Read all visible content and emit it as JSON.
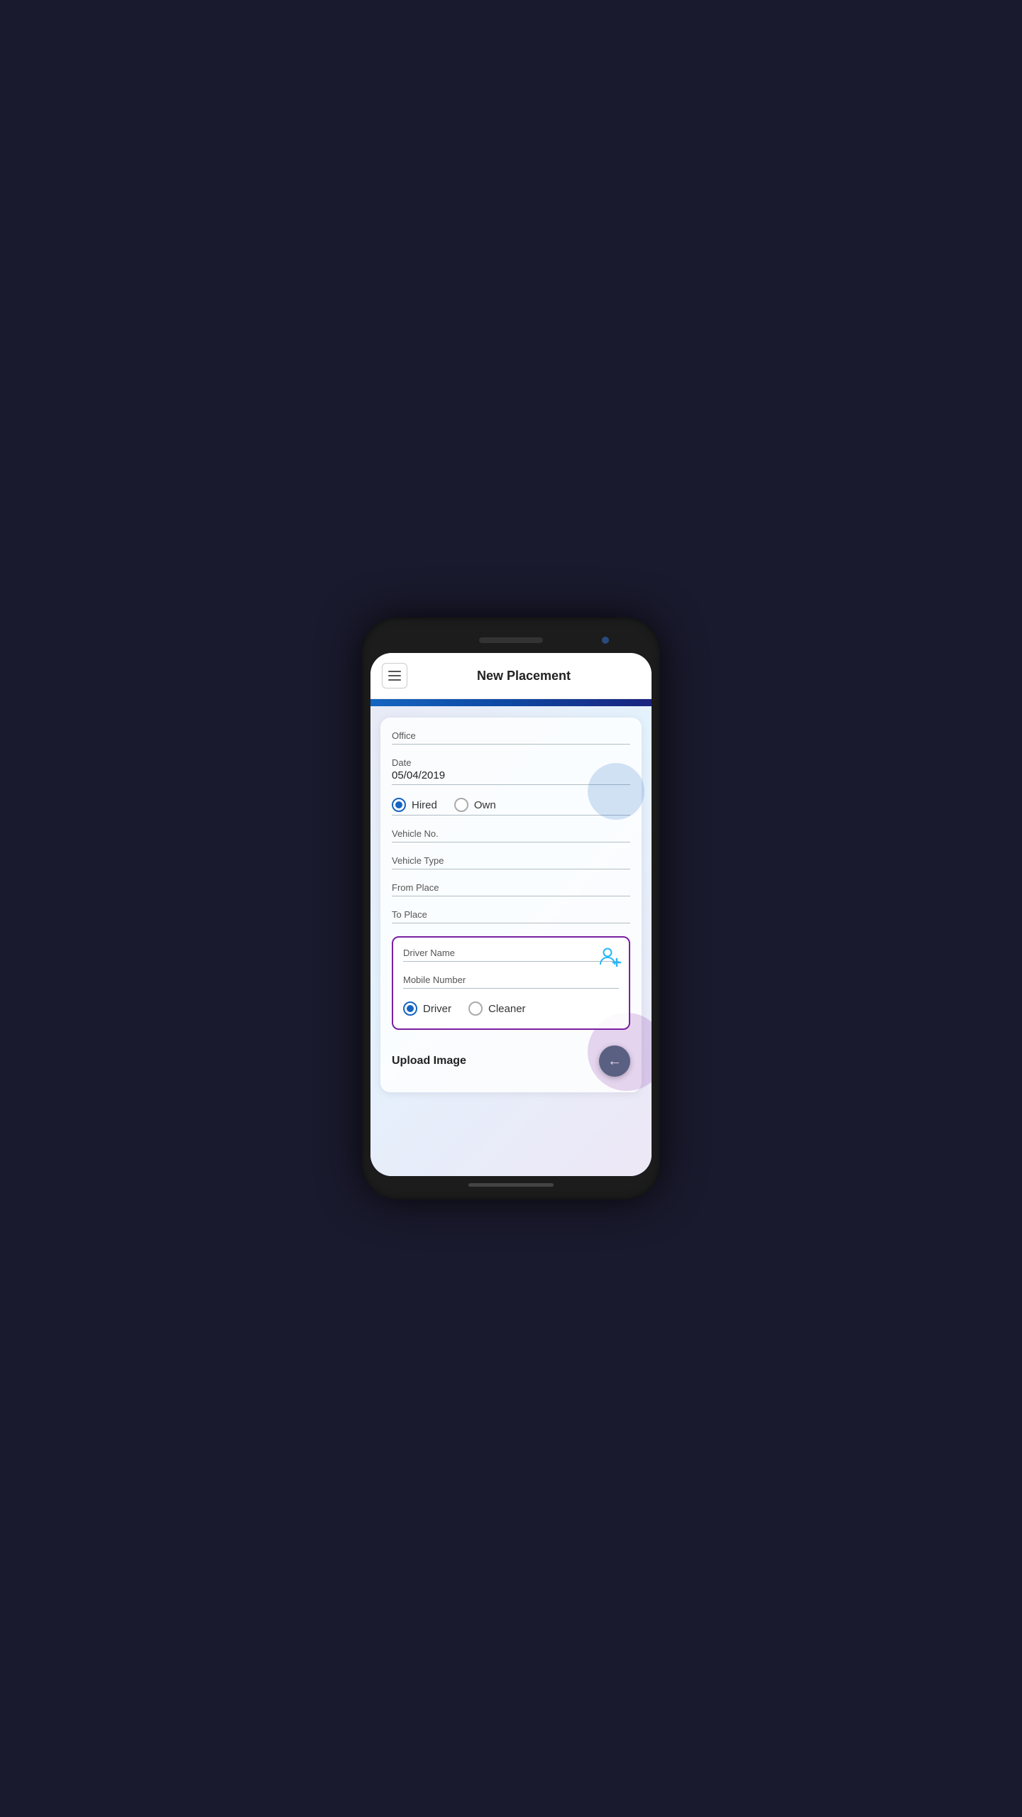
{
  "header": {
    "title": "New Placement",
    "menu_label": "menu"
  },
  "form": {
    "office_label": "Office",
    "office_value": "",
    "date_label": "Date",
    "date_value": "05/04/2019",
    "hired_label": "Hired",
    "own_label": "Own",
    "hired_selected": true,
    "vehicle_no_label": "Vehicle No.",
    "vehicle_type_label": "Vehicle Type",
    "from_place_label": "From Place",
    "to_place_label": "To Place",
    "driver_name_label": "Driver Name",
    "mobile_number_label": "Mobile Number",
    "driver_label": "Driver",
    "cleaner_label": "Cleaner",
    "driver_selected": true,
    "upload_image_label": "Upload Image"
  },
  "icons": {
    "back_arrow": "←",
    "add_person": "person-add-icon"
  }
}
